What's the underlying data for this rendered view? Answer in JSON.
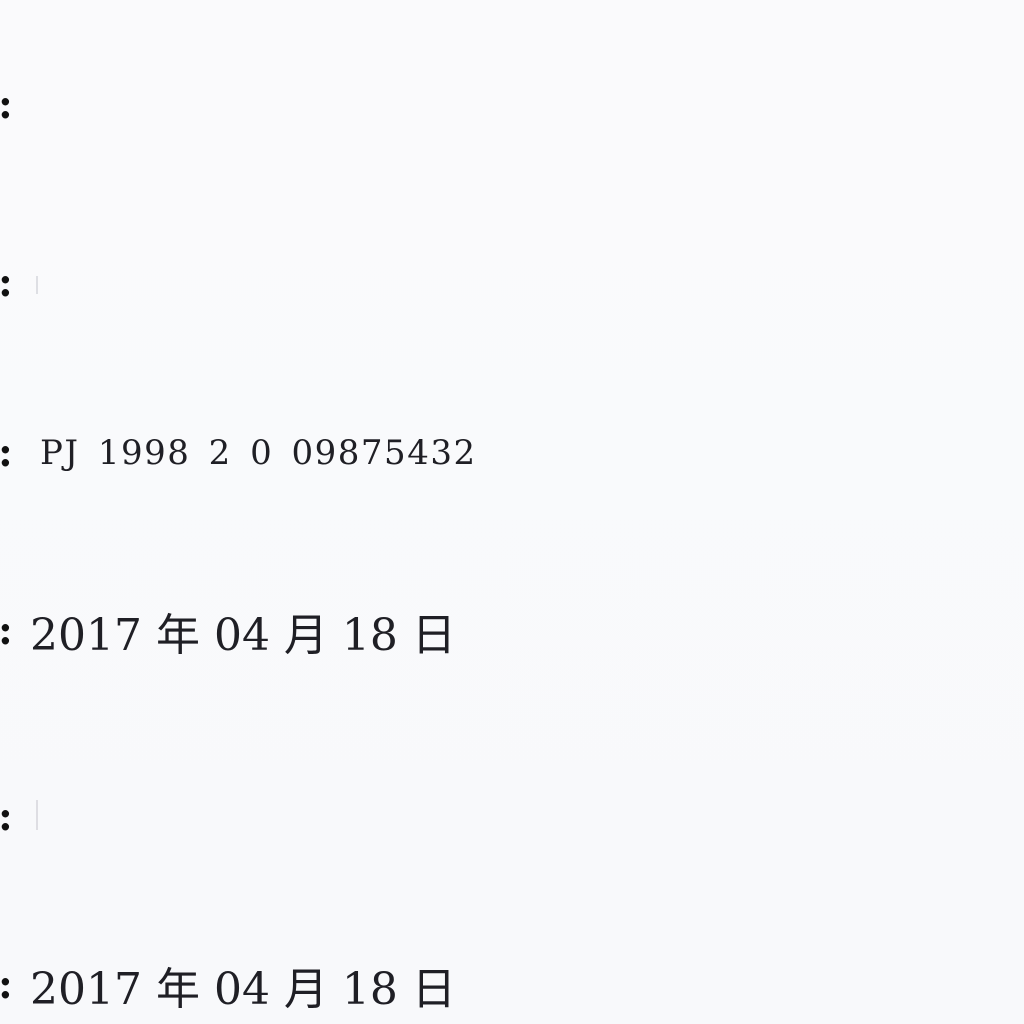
{
  "fields": [
    {
      "colon": ":",
      "value": ""
    },
    {
      "colon": ":",
      "value": ""
    },
    {
      "colon": ":",
      "value": "PJ 1998 2 0 09875432"
    },
    {
      "colon": ":",
      "value": "2017 年 04 月 18 日"
    },
    {
      "colon": ":",
      "value": ""
    },
    {
      "colon": ":",
      "value": "2017 年 04 月 18 日"
    }
  ]
}
